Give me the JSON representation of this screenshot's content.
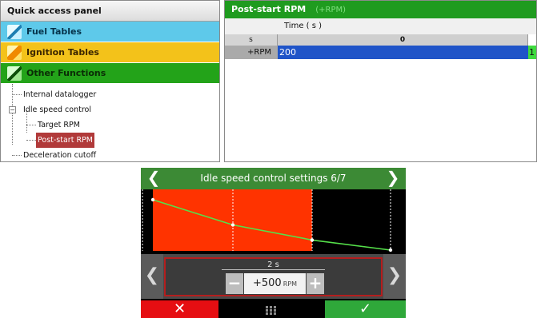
{
  "quick_panel": {
    "title": "Quick access panel",
    "items": [
      {
        "label": "Fuel Tables",
        "icon": "fuel-tables-icon"
      },
      {
        "label": "Ignition Tables",
        "icon": "ignition-tables-icon"
      },
      {
        "label": "Other Functions",
        "icon": "other-functions-icon"
      }
    ],
    "tree": [
      {
        "label": "Internal datalogger"
      },
      {
        "label": "Idle speed control",
        "toggle": "−"
      },
      {
        "label": "Target RPM"
      },
      {
        "label": "Post-start RPM",
        "selected": true
      },
      {
        "label": "Deceleration cutoff"
      }
    ]
  },
  "table_panel": {
    "title": "Post-start RPM",
    "unit": "(+RPM)",
    "axis_label": "Time   ( s )",
    "corner_label": "s",
    "columns": [
      "0"
    ],
    "row_label": "+RPM",
    "cell_values": [
      "200",
      "1"
    ]
  },
  "device": {
    "title": "Idle speed control settings 6/7",
    "time_label": "2 s",
    "value": "+500",
    "value_unit": "RPM",
    "glyphs": {
      "prev": "❮",
      "next": "❯",
      "minus": "−",
      "plus": "+",
      "cancel": "✕",
      "confirm": "✓"
    },
    "chart_points": [
      1000,
      500,
      200,
      0
    ],
    "colors": {
      "active_bg": "#ff3300",
      "line": "#55e04a",
      "header": "#3c8a35",
      "cancel": "#e60e12",
      "confirm": "#2fa83a"
    }
  }
}
